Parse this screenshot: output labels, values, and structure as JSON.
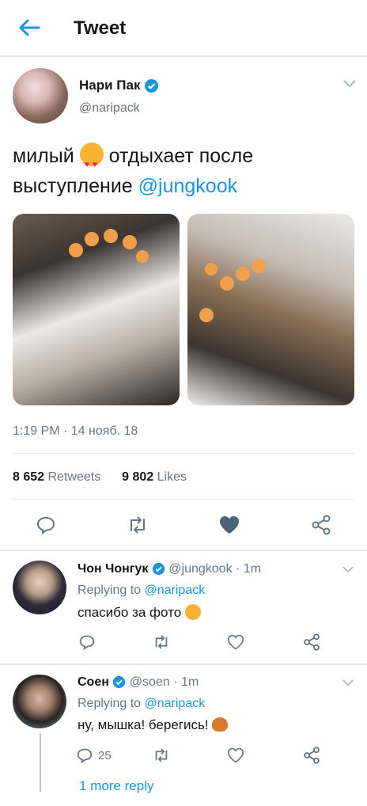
{
  "header": {
    "title": "Tweet"
  },
  "tweet": {
    "name": "Нари Пак",
    "handle": "@naripack",
    "text_before": "милый",
    "text_after": "отдыхает после выступление",
    "mention": "@jungkook",
    "timestamp": "1:19 PM · 14 нояб. 18",
    "retweets_count": "8 652",
    "retweets_label": "Retweets",
    "likes_count": "9 802",
    "likes_label": "Likes"
  },
  "replies": [
    {
      "name": "Чон Чонгук",
      "handle": "@jungkook",
      "time": "· 1m",
      "replying_prefix": "Replying to",
      "replying_to": "@naripack",
      "text": "спасибо за фото",
      "reply_count": ""
    },
    {
      "name": "Соен",
      "handle": "@soen",
      "time": "· 1m",
      "replying_prefix": "Replying to",
      "replying_to": "@naripack",
      "text": "ну, мышка! берегись!",
      "reply_count": "25"
    }
  ],
  "more_replies": "1 more reply",
  "colors": {
    "accent": "#1b95e0",
    "icon": "#657786",
    "liked": "#4a6378"
  }
}
